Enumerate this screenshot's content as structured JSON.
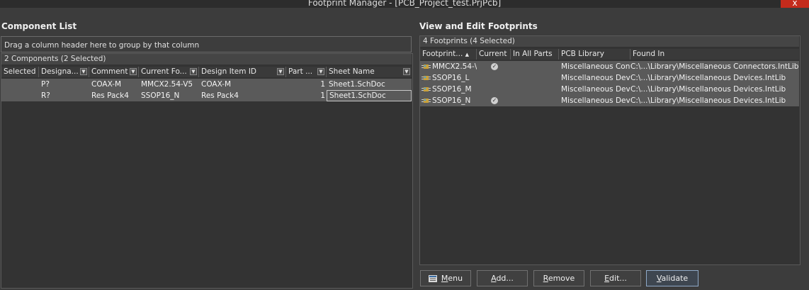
{
  "window": {
    "title": "Footprint Manager - [PCB_Project_test.PrjPcb]",
    "close_glyph": "x"
  },
  "component_list": {
    "title": "Component List",
    "group_hint": "Drag a column header here to group by that column",
    "count": "2 Components (2 Selected)",
    "columns": [
      "Selected",
      "Designa...",
      "Comment",
      "Current Fo...",
      "Design Item ID",
      "Part ...",
      "Sheet Name"
    ],
    "filter_glyph": "▼",
    "rows": [
      {
        "selected": "",
        "designator": "P?",
        "comment": "COAX-M",
        "current_footprint": "MMCX2.54-V5",
        "design_item_id": "COAX-M",
        "part": "1",
        "sheet": "Sheet1.SchDoc"
      },
      {
        "selected": "",
        "designator": "R?",
        "comment": "Res Pack4",
        "current_footprint": "SSOP16_N",
        "design_item_id": "Res Pack4",
        "part": "1",
        "sheet": "Sheet1.SchDoc"
      }
    ]
  },
  "footprints": {
    "title": "View and Edit Footprints",
    "count": "4 Footprints (4 Selected)",
    "columns": [
      "Footprint...",
      "Current",
      "In All Parts",
      "PCB Library",
      "Found In"
    ],
    "sort_glyph": "▲",
    "check_glyph": "✓",
    "rows": [
      {
        "name": "MMCX2.54-\\",
        "current": true,
        "library": "Miscellaneous Con",
        "found_in": "C:\\...\\Library\\Miscellaneous Connectors.IntLib"
      },
      {
        "name": "SSOP16_L",
        "current": false,
        "library": "Miscellaneous Devi",
        "found_in": "C:\\...\\Library\\Miscellaneous Devices.IntLib"
      },
      {
        "name": "SSOP16_M",
        "current": false,
        "library": "Miscellaneous Devi",
        "found_in": "C:\\...\\Library\\Miscellaneous Devices.IntLib"
      },
      {
        "name": "SSOP16_N",
        "current": true,
        "library": "Miscellaneous Devi",
        "found_in": "C:\\...\\Library\\Miscellaneous Devices.IntLib"
      }
    ]
  },
  "buttons": {
    "menu": {
      "first": "M",
      "rest": "enu"
    },
    "add": {
      "first": "A",
      "rest": "dd..."
    },
    "remove": {
      "first": "R",
      "rest": "emove"
    },
    "edit": {
      "first": "E",
      "rest": "dit..."
    },
    "validate": {
      "first": "V",
      "rest": "alidate"
    }
  },
  "colors": {
    "selected_row": "#5a5a5a",
    "close": "#c42b1c",
    "focus_border": "#8fa9c8"
  }
}
